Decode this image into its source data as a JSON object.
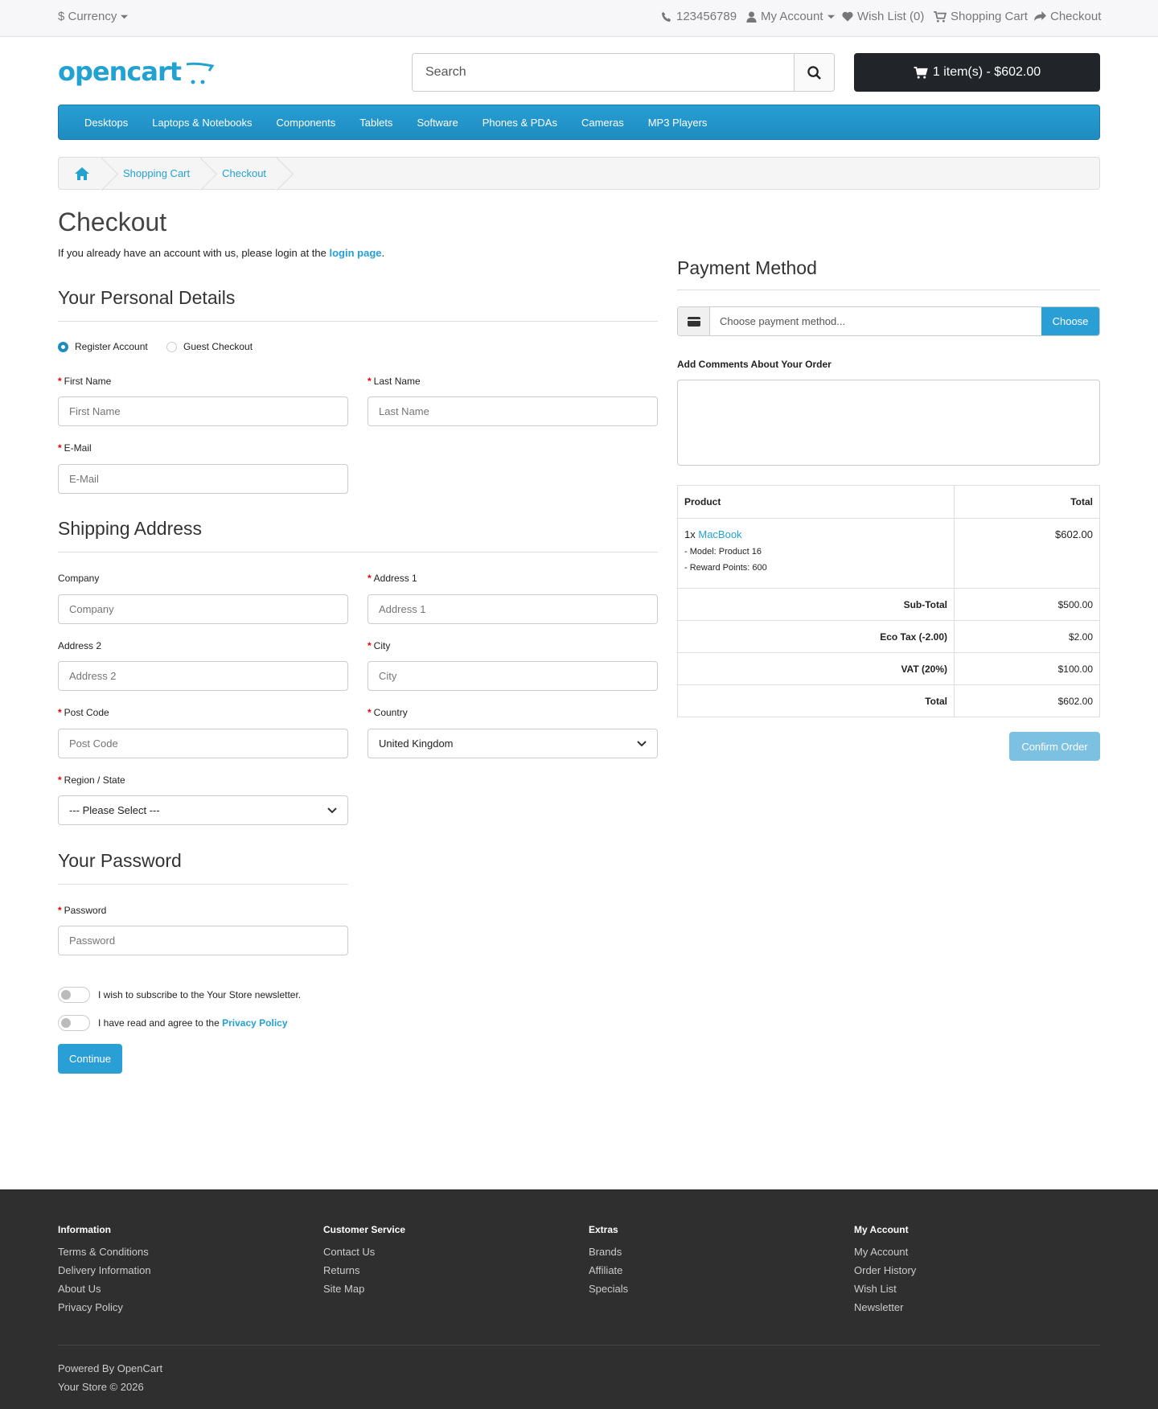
{
  "topbar": {
    "currency": "$ Currency",
    "phone": "123456789",
    "my_account": "My Account",
    "wish_list": "Wish List (0)",
    "shopping_cart": "Shopping Cart",
    "checkout": "Checkout"
  },
  "header": {
    "logo_text": "opencart",
    "search_placeholder": "Search",
    "cart_button": "1 item(s) - $602.00"
  },
  "menu": [
    "Desktops",
    "Laptops & Notebooks",
    "Components",
    "Tablets",
    "Software",
    "Phones & PDAs",
    "Cameras",
    "MP3 Players"
  ],
  "breadcrumb": [
    "Shopping Cart",
    "Checkout"
  ],
  "page": {
    "title": "Checkout",
    "intro_pre": "If you already have an account with us, please login at the ",
    "intro_link": "login page",
    "intro_post": "."
  },
  "personal": {
    "heading": "Your Personal Details",
    "register": "Register Account",
    "guest": "Guest Checkout",
    "first_name_label": "First Name",
    "first_name_placeholder": "First Name",
    "last_name_label": "Last Name",
    "last_name_placeholder": "Last Name",
    "email_label": "E-Mail",
    "email_placeholder": "E-Mail"
  },
  "shipping": {
    "heading": "Shipping Address",
    "company_label": "Company",
    "company_placeholder": "Company",
    "address1_label": "Address 1",
    "address1_placeholder": "Address 1",
    "address2_label": "Address 2",
    "address2_placeholder": "Address 2",
    "city_label": "City",
    "city_placeholder": "City",
    "postcode_label": "Post Code",
    "postcode_placeholder": "Post Code",
    "country_label": "Country",
    "country_value": "United Kingdom",
    "region_label": "Region / State",
    "region_value": "--- Please Select ---"
  },
  "password": {
    "heading": "Your Password",
    "label": "Password",
    "placeholder": "Password"
  },
  "agree": {
    "newsletter": "I wish to subscribe to the Your Store newsletter.",
    "privacy_pre": "I have read and agree to the ",
    "privacy_link": "Privacy Policy",
    "continue": "Continue"
  },
  "payment": {
    "heading": "Payment Method",
    "placeholder": "Choose payment method...",
    "choose": "Choose",
    "comments_label": "Add Comments About Your Order"
  },
  "cart": {
    "col_product": "Product",
    "col_total": "Total",
    "qty": "1x",
    "product": "MacBook",
    "model": "- Model: Product 16",
    "reward": "- Reward Points: 600",
    "line_total": "$602.00",
    "totals": [
      {
        "label": "Sub-Total",
        "value": "$500.00"
      },
      {
        "label": "Eco Tax (-2.00)",
        "value": "$2.00"
      },
      {
        "label": "VAT (20%)",
        "value": "$100.00"
      },
      {
        "label": "Total",
        "value": "$602.00"
      }
    ],
    "confirm": "Confirm Order"
  },
  "footer": {
    "columns": [
      {
        "heading": "Information",
        "links": [
          "Terms & Conditions",
          "Delivery Information",
          "About Us",
          "Privacy Policy"
        ]
      },
      {
        "heading": "Customer Service",
        "links": [
          "Contact Us",
          "Returns",
          "Site Map"
        ]
      },
      {
        "heading": "Extras",
        "links": [
          "Brands",
          "Affiliate",
          "Specials"
        ]
      },
      {
        "heading": "My Account",
        "links": [
          "My Account",
          "Order History",
          "Wish List",
          "Newsletter"
        ]
      }
    ],
    "powered": "Powered By OpenCart",
    "copyright": "Your Store © 2026"
  },
  "colors": {
    "accent": "#23a1d1",
    "menu": "#229ac8",
    "footer": "#2f2f2f"
  }
}
